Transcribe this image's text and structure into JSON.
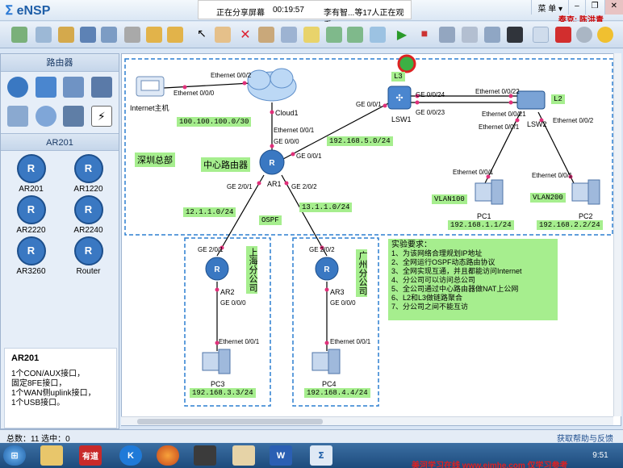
{
  "app": {
    "logo": "eNSP"
  },
  "share": {
    "status": "正在分享屏幕",
    "timer": "00:19:57",
    "viewers": "李有智...等17人正在观看"
  },
  "window": {
    "menu": "菜 单",
    "minimize": "–",
    "restore": "❐",
    "close": "✕",
    "instructor": "泰克: 陈洪青"
  },
  "left": {
    "routers_heading": "路由器",
    "category_heading": "AR201",
    "devices": [
      {
        "label": "AR201"
      },
      {
        "label": "AR1220"
      },
      {
        "label": "AR2220"
      },
      {
        "label": "AR2240"
      },
      {
        "label": "AR3260"
      },
      {
        "label": "Router"
      }
    ],
    "desc_title": "AR201",
    "desc_lines": [
      "1个CON/AUX接口，",
      "固定8FE接口，",
      "1个WAN侧uplink接口，",
      "1个USB接口。"
    ]
  },
  "topology": {
    "devices": {
      "internet_host": "Internet主机",
      "cloud": "Cloud1",
      "ar1": "AR1",
      "ar2": "AR2",
      "ar3": "AR3",
      "lsw1": "LSW1",
      "lsw2": "LSW2",
      "pc1": "PC1",
      "pc2": "PC2",
      "pc3": "PC3",
      "pc4": "PC4"
    },
    "ports": {
      "host_e000": "Ethernet 0/0/0",
      "cloud_e002": "Ethernet 0/0/2",
      "cloud_e001": "Ethernet 0/0/1",
      "ar1_ge000": "GE 0/0/0",
      "ar1_ge001": "GE 0/0/1",
      "lsw1_ge001": "GE 0/0/1",
      "lsw1_ge0024": "GE 0/0/24",
      "lsw1_ge0023": "GE 0/0/23",
      "lsw2_e0022": "Ethernet 0/0/22",
      "lsw2_e0021": "Ethernet 0/0/21",
      "lsw2_e001": "Ethernet 0/0/1",
      "lsw2_e002": "Ethernet 0/0/2",
      "pc1_e001": "Ethernet 0/0/1",
      "pc2_e001": "Ethernet 0/0/1",
      "ar1_ge201": "GE 2/0/1",
      "ar1_ge202": "GE 2/0/2",
      "ar2_ge201": "GE 2/0/1",
      "ar2_ge000": "GE 0/0/0",
      "ar3_ge202": "GE 2/0/2",
      "ar3_ge000": "GE 0/0/0",
      "pc3_e001": "Ethernet 0/0/1",
      "pc4_e001": "Ethernet 0/0/1"
    },
    "labels": {
      "net_public": "100.100.100.0/30",
      "net_core": "192.168.5.0/24",
      "center_router": "中心路由器",
      "hq": "深圳总部",
      "l3": "L3",
      "l2": "L2",
      "vlan100": "VLAN100",
      "vlan200": "VLAN200",
      "pc1_net": "192.168.1.1/24",
      "pc2_net": "192.168.2.2/24",
      "net_sh": "12.1.1.0/24",
      "net_gz": "13.1.1.0/24",
      "ospf": "OSPF",
      "shanghai": "上海分公司",
      "guangzhou": "广州分公司",
      "pc3_net": "192.168.3.3/24",
      "pc4_net": "192.168.4.4/24"
    },
    "requirements": {
      "title": "实验要求：",
      "items": [
        "1、为该网络合理规划IP地址",
        "2、全网运行OSPF动态路由协议",
        "3、全网实现互通，并且都能访问Internet",
        "4、分公司可以访问总公司",
        "5、全公司通过中心路由器做NAT上公网",
        "6、L2和L3做链路聚合",
        "7、分公司之间不能互访"
      ]
    }
  },
  "status": {
    "total": "总数：11  选中：0",
    "help": "获取帮助与反馈"
  },
  "taskbar": {
    "clock": "9:51",
    "youdao": "有道",
    "word": "W"
  },
  "watermark": "美河学习在线 www.eimhe.com 仅学习参考",
  "colors": {
    "accent": "#1f5fa8",
    "label_bg": "#a6ee8e",
    "dashed": "#2b7fd0"
  }
}
